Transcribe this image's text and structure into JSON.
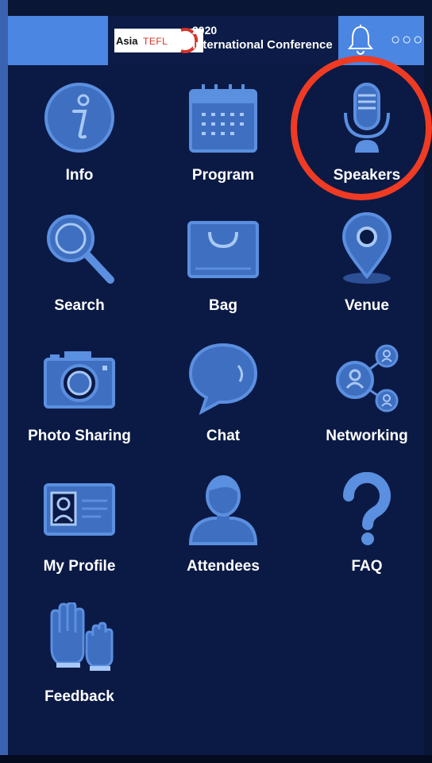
{
  "header": {
    "logo": {
      "asia": "Asia",
      "tefl": "TEFL"
    },
    "conference_year": "2020",
    "conference_name": "International Conference",
    "more_label": "○○○",
    "bell_icon": "bell-icon"
  },
  "menu": {
    "items": [
      {
        "label": "Info",
        "icon": "info-icon"
      },
      {
        "label": "Program",
        "icon": "calendar-icon"
      },
      {
        "label": "Speakers",
        "icon": "microphone-icon"
      },
      {
        "label": "Search",
        "icon": "magnifier-icon"
      },
      {
        "label": "Bag",
        "icon": "bag-icon"
      },
      {
        "label": "Venue",
        "icon": "map-pin-icon"
      },
      {
        "label": "Photo Sharing",
        "icon": "camera-icon"
      },
      {
        "label": "Chat",
        "icon": "chat-bubble-icon"
      },
      {
        "label": "Networking",
        "icon": "networking-icon"
      },
      {
        "label": "My Profile",
        "icon": "id-card-icon"
      },
      {
        "label": "Attendees",
        "icon": "person-icon"
      },
      {
        "label": "FAQ",
        "icon": "question-icon"
      },
      {
        "label": "Feedback",
        "icon": "raised-hands-icon"
      }
    ]
  },
  "colors": {
    "background": "#0b1a45",
    "header_accent": "#4a86e2",
    "icon_fill": "#3f6fc0",
    "icon_stroke": "#5b8fe0",
    "highlight": "#ef3b24"
  }
}
